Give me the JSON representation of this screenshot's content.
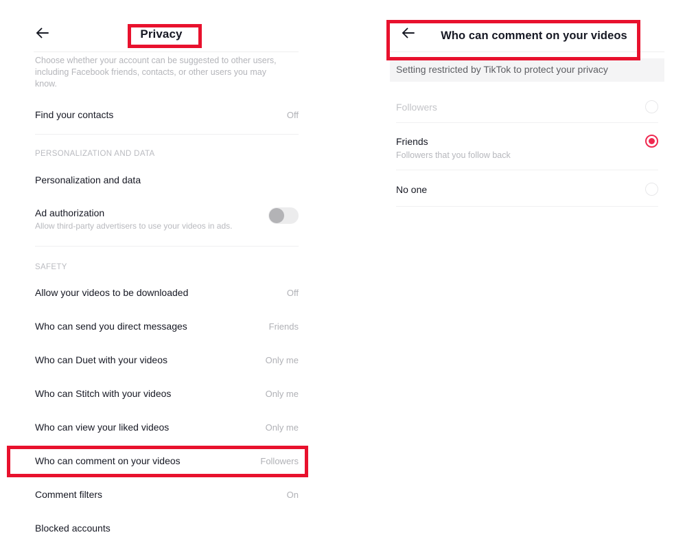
{
  "left_panel": {
    "back_icon": "back-arrow-icon",
    "title": "Privacy",
    "description": "Choose whether your account can be suggested to other users, including Facebook friends, contacts, or other users you may know.",
    "rows_top": [
      {
        "label": "Find your contacts",
        "value": "Off"
      }
    ],
    "group_personalization": {
      "header": "PERSONALIZATION AND DATA",
      "rows": [
        {
          "label": "Personalization and data",
          "value": ""
        },
        {
          "label": "Ad authorization",
          "sub": "Allow third-party advertisers to use your videos in ads.",
          "toggle": "off"
        }
      ]
    },
    "group_safety": {
      "header": "SAFETY",
      "rows": [
        {
          "label": "Allow your videos to be downloaded",
          "value": "Off"
        },
        {
          "label": "Who can send you direct messages",
          "value": "Friends"
        },
        {
          "label": "Who can Duet with your videos",
          "value": "Only me"
        },
        {
          "label": "Who can Stitch with your videos",
          "value": "Only me"
        },
        {
          "label": "Who can view your liked videos",
          "value": "Only me"
        },
        {
          "label": "Who can comment on your videos",
          "value": "Followers"
        },
        {
          "label": "Comment filters",
          "value": "On"
        },
        {
          "label": "Blocked accounts",
          "value": ""
        }
      ]
    }
  },
  "right_panel": {
    "back_icon": "back-arrow-icon",
    "title": "Who can comment on your videos",
    "notice": "Setting restricted by TikTok to protect your privacy",
    "options": [
      {
        "label": "Followers",
        "sub": "",
        "selected": false,
        "disabled": true
      },
      {
        "label": "Friends",
        "sub": "Followers that you follow back",
        "selected": true,
        "disabled": false
      },
      {
        "label": "No one",
        "sub": "",
        "selected": false,
        "disabled": false
      }
    ]
  },
  "annotations": {
    "color": "#e8112d",
    "boxes": [
      {
        "name": "privacy-title-highlight"
      },
      {
        "name": "comment-row-highlight"
      },
      {
        "name": "right-header-highlight"
      }
    ]
  }
}
